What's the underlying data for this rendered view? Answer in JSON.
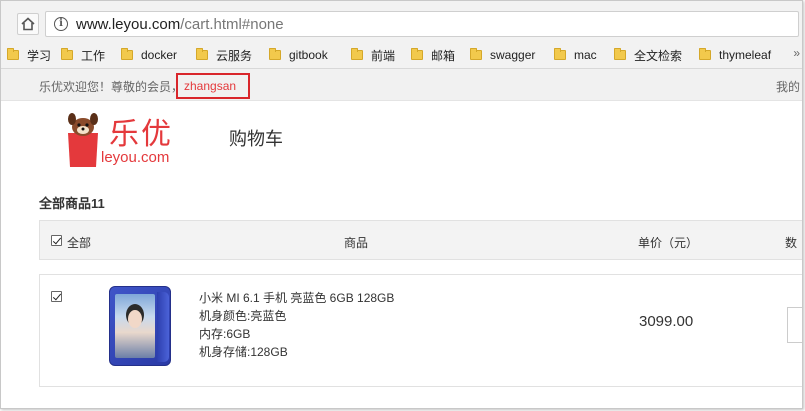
{
  "browser": {
    "url_host": "www.leyou.com",
    "url_path": "/cart.html#none",
    "home_icon": "home-icon",
    "info_icon": "info-icon",
    "info_glyph": "i"
  },
  "bookmarks": [
    {
      "label": "学习"
    },
    {
      "label": "工作"
    },
    {
      "label": "docker"
    },
    {
      "label": "云服务"
    },
    {
      "label": "gitbook"
    },
    {
      "label": "前端"
    },
    {
      "label": "邮箱"
    },
    {
      "label": "swagger"
    },
    {
      "label": "mac"
    },
    {
      "label": "全文检索"
    },
    {
      "label": "thymeleaf"
    }
  ],
  "bookmarks_more": "»",
  "site": {
    "welcome_text": "乐优欢迎您！尊敬的会员，",
    "username": "zhangsan",
    "top_right_text": "我的",
    "logo_text": "乐优",
    "logo_domain": "leyou.com",
    "page_title": "购物车",
    "colors": {
      "accent": "#e4393c",
      "logo_red": "#d9262b"
    }
  },
  "cart": {
    "all_count_label": "全部商品11",
    "header": {
      "select_all": "全部",
      "product": "商品",
      "unit_price": "单价（元）",
      "quantity": "数"
    },
    "items": [
      {
        "checked": true,
        "name": "小米 MI 6.1 手机 亮蓝色 6GB 128GB",
        "attrs": [
          "机身颜色:亮蓝色",
          "内存:6GB",
          "机身存储:128GB"
        ],
        "price": "3099.00"
      }
    ]
  }
}
